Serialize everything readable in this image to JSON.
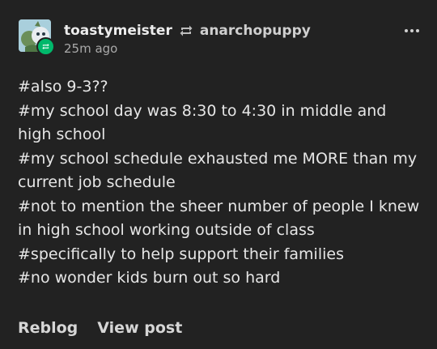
{
  "post": {
    "author": "toastymeister",
    "reblogged_from": "anarchopuppy",
    "timestamp": "25m ago",
    "avatar_icon": "avatar-image",
    "reblog_icon": "reblog-icon",
    "menu_icon": "more-horizontal-icon",
    "tags": [
      "#also 9-3??",
      "#my school day was 8:30 to 4:30 in middle and high school",
      "#my school schedule exhausted me MORE than my current job schedule",
      "#not to mention the sheer number of people I knew in high school working outside of class",
      "#specifically to help support their families",
      "#no wonder kids burn out so hard"
    ],
    "actions": {
      "reblog_label": "Reblog",
      "view_post_label": "View post"
    }
  },
  "colors": {
    "background": "#222222",
    "badge": "#00b86b"
  }
}
